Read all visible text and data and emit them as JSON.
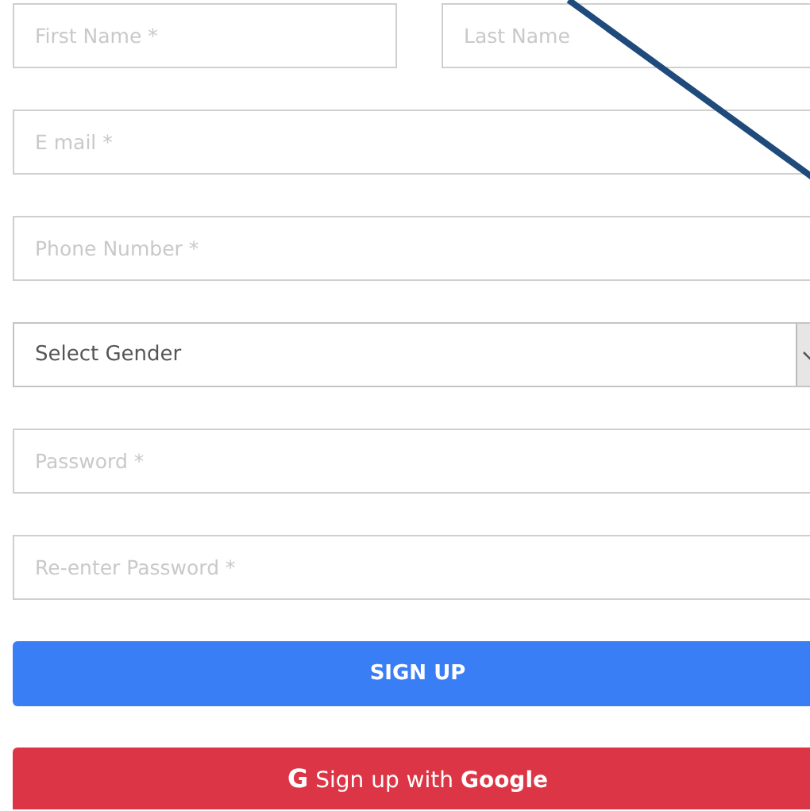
{
  "form": {
    "name_row": [
      {
        "placeholder": "First Name *"
      },
      {
        "placeholder": "Last Name"
      }
    ],
    "fields": [
      {
        "kind": "input",
        "placeholder": "E mail *"
      },
      {
        "kind": "input",
        "placeholder": "Phone Number *"
      },
      {
        "kind": "select",
        "value": "Select Gender"
      },
      {
        "kind": "input",
        "placeholder": "Password *"
      },
      {
        "kind": "input",
        "placeholder": "Re-enter Password *"
      }
    ],
    "submit_button": {
      "label": "SIGN UP"
    },
    "google_button": {
      "icon": "G",
      "label": "Sign up with **Google**"
    }
  }
}
